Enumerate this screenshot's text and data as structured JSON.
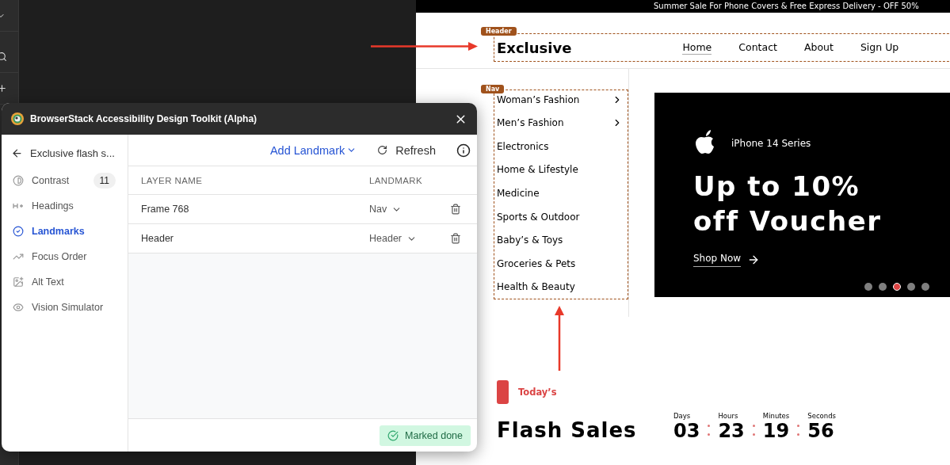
{
  "website": {
    "promo_banner": "Summer Sale For Phone Covers & Free Express Delivery - OFF 50%",
    "header_tag": "Header",
    "logo": "Exclusive",
    "nav_links": [
      {
        "label": "Home",
        "selected": true
      },
      {
        "label": "Contact",
        "selected": false
      },
      {
        "label": "About",
        "selected": false
      },
      {
        "label": "Sign Up",
        "selected": false
      }
    ],
    "nav_tag": "Nav",
    "categories": [
      {
        "label": "Woman’s Fashion",
        "has_submenu": true
      },
      {
        "label": "Men’s Fashion",
        "has_submenu": true
      },
      {
        "label": "Electronics",
        "has_submenu": false
      },
      {
        "label": "Home & Lifestyle",
        "has_submenu": false
      },
      {
        "label": "Medicine",
        "has_submenu": false
      },
      {
        "label": "Sports & Outdoor",
        "has_submenu": false
      },
      {
        "label": "Baby’s & Toys",
        "has_submenu": false
      },
      {
        "label": "Groceries & Pets",
        "has_submenu": false
      },
      {
        "label": "Health & Beauty",
        "has_submenu": false
      }
    ],
    "hero": {
      "subtitle": "iPhone 14 Series",
      "headline": [
        "Up to 10%",
        "off Voucher"
      ],
      "cta": "Shop Now",
      "slides": [
        {
          "selected": false
        },
        {
          "selected": false
        },
        {
          "selected": true
        },
        {
          "selected": false
        },
        {
          "selected": false
        }
      ]
    },
    "flash": {
      "eyebrow": "Today’s",
      "title": "Flash Sales",
      "countdown": [
        {
          "label": "Days",
          "value": "03"
        },
        {
          "label": "Hours",
          "value": "23"
        },
        {
          "label": "Minutes",
          "value": "19"
        },
        {
          "label": "Seconds",
          "value": "56"
        }
      ]
    }
  },
  "plugin": {
    "title": "BrowserStack Accessibility Design Toolkit (Alpha)",
    "back_label": "Exclusive flash s...",
    "nav": [
      {
        "kind": "contrast",
        "label": "Contrast",
        "count": "11",
        "selected": false
      },
      {
        "kind": "headings",
        "label": "Headings",
        "selected": false
      },
      {
        "kind": "landmarks",
        "label": "Landmarks",
        "selected": true
      },
      {
        "kind": "focus",
        "label": "Focus Order",
        "selected": false
      },
      {
        "kind": "alt",
        "label": "Alt Text",
        "selected": false
      },
      {
        "kind": "vision",
        "label": "Vision Simulator",
        "selected": false
      }
    ],
    "add_landmark": "Add Landmark",
    "refresh": "Refresh",
    "columns": [
      "LAYER NAME",
      "LANDMARK"
    ],
    "rows": [
      {
        "layer": "Frame 768",
        "landmark": "Nav"
      },
      {
        "layer": "Header",
        "landmark": "Header"
      }
    ],
    "status": "Marked done"
  }
}
